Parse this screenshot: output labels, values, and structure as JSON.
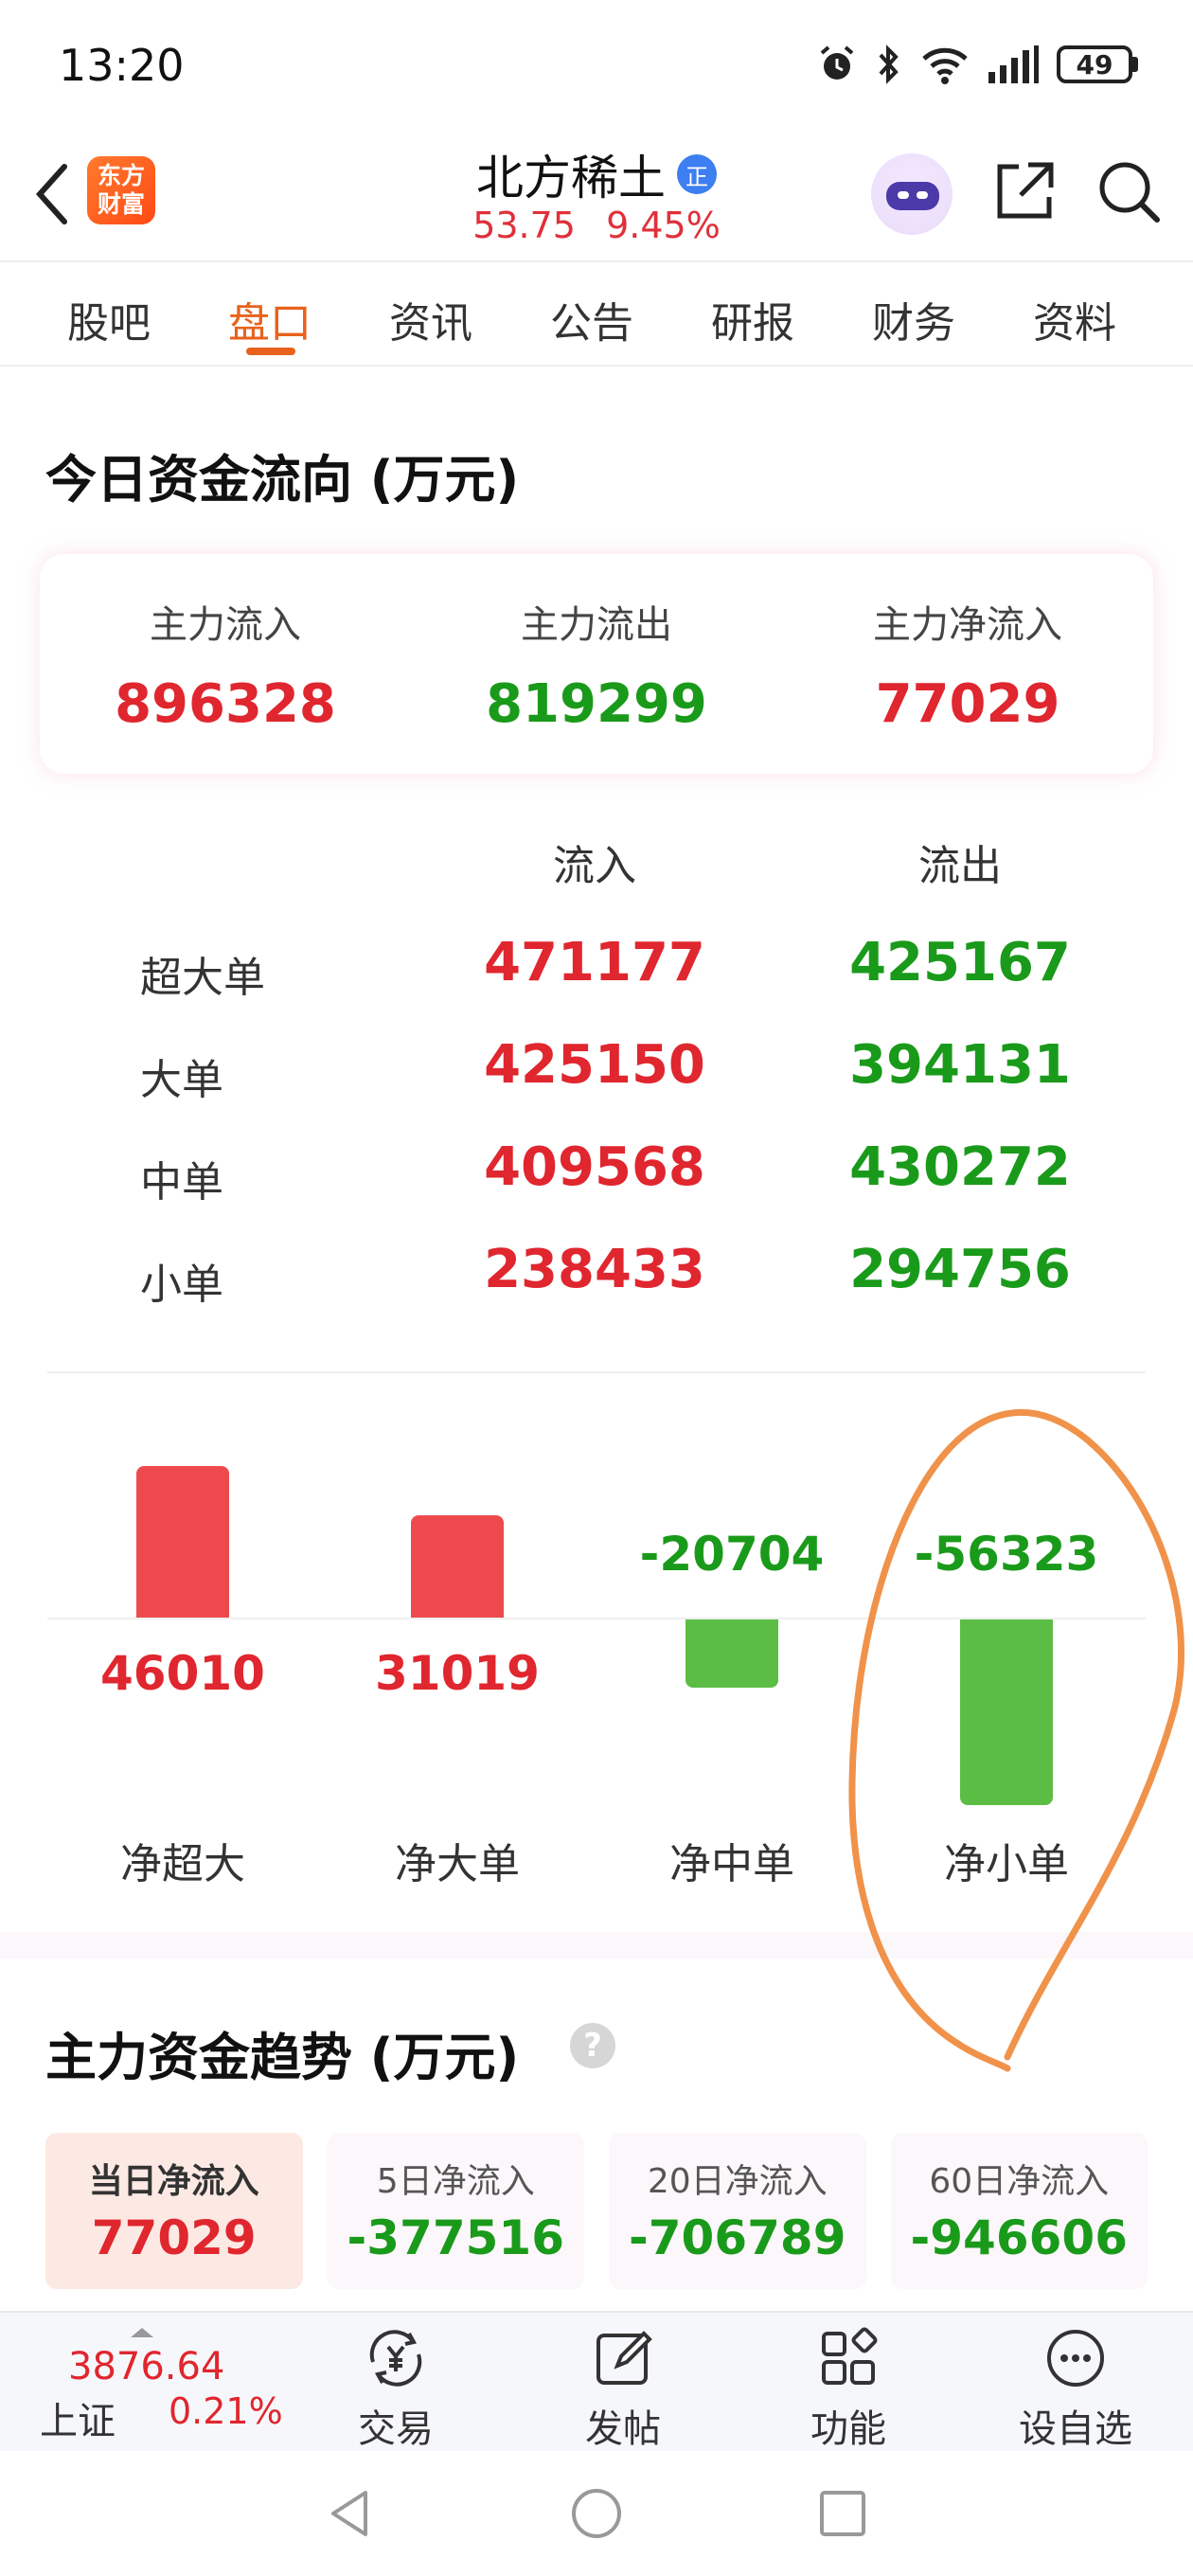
{
  "status_bar": {
    "time": "13:20",
    "battery": "49"
  },
  "header": {
    "app_logo": "东方财富",
    "stock_name": "北方稀土",
    "badge": "正",
    "price": "53.75",
    "change_pct": "9.45%"
  },
  "tabs": [
    {
      "label": "股吧"
    },
    {
      "label": "盘口"
    },
    {
      "label": "资讯"
    },
    {
      "label": "公告"
    },
    {
      "label": "研报"
    },
    {
      "label": "财务"
    },
    {
      "label": "资料"
    }
  ],
  "fund_flow": {
    "title": "今日资金流向 (万元)",
    "summary": {
      "inflow_label": "主力流入",
      "inflow_value": "896328",
      "outflow_label": "主力流出",
      "outflow_value": "819299",
      "net_label": "主力净流入",
      "net_value": "77029"
    },
    "col_in": "流入",
    "col_out": "流出",
    "rows": [
      {
        "label": "超大单",
        "in": "471177",
        "out": "425167"
      },
      {
        "label": "大单",
        "in": "425150",
        "out": "394131"
      },
      {
        "label": "中单",
        "in": "409568",
        "out": "430272"
      },
      {
        "label": "小单",
        "in": "238433",
        "out": "294756"
      }
    ]
  },
  "chart_data": {
    "type": "bar",
    "categories": [
      "净超大",
      "净大单",
      "净中单",
      "净小单"
    ],
    "values": [
      46010,
      31019,
      -20704,
      -56323
    ],
    "value_labels": [
      "46010",
      "31019",
      "-20704",
      "-56323"
    ],
    "positive_color": "#ee4a4e",
    "negative_color": "#5cbd45",
    "title": "",
    "xlabel": "",
    "ylabel": ""
  },
  "trend": {
    "title": "主力资金趋势 (万元)",
    "help_icon": "?",
    "cards": [
      {
        "label": "当日净流入",
        "value": "77029"
      },
      {
        "label": "5日净流入",
        "value": "-377516"
      },
      {
        "label": "20日净流入",
        "value": "-706789"
      },
      {
        "label": "60日净流入",
        "value": "-946606"
      }
    ]
  },
  "bottom_nav": {
    "index_value": "3876.64",
    "index_name": "上证",
    "index_pct": "0.21%",
    "items": [
      {
        "label": "交易",
        "icon": "yuan-cycle-icon"
      },
      {
        "label": "发帖",
        "icon": "edit-icon"
      },
      {
        "label": "功能",
        "icon": "grid-icon"
      },
      {
        "label": "设自选",
        "icon": "more-icon"
      }
    ]
  },
  "colors": {
    "accent": "#e8621d",
    "up": "#e0262e",
    "down": "#1a9a1a",
    "annotation": "#f0924a"
  }
}
